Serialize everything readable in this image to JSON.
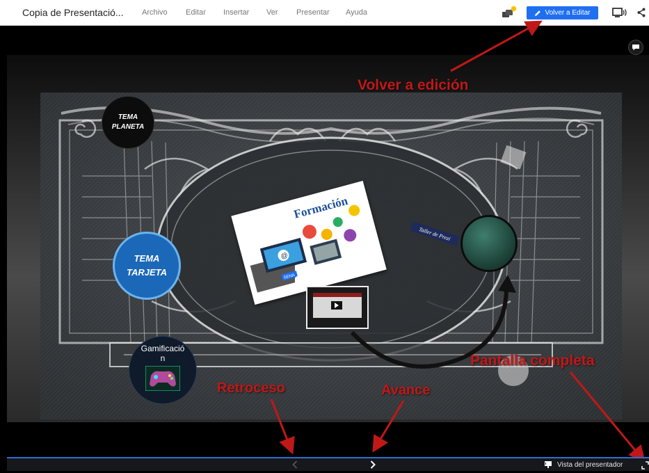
{
  "app": {
    "doc_title": "Copia de Presentació...",
    "menu": [
      "Archivo",
      "Editar",
      "Insertar",
      "Ver",
      "Presentar",
      "Ayuda"
    ],
    "edit_button_label": "Volver a Editar"
  },
  "slide": {
    "tema_planeta": [
      "TEMA",
      "PLANETA"
    ],
    "tema_tarjeta": [
      "TEMA",
      "TARJETA"
    ],
    "gamificacion": [
      "Gamificació",
      "n"
    ],
    "formacion_logo": "Formación",
    "taller_label": "Taller de Prezi",
    "badge_text": "SENA"
  },
  "annotations": {
    "volver": "Volver a edición",
    "pantalla": "Pantalla completa",
    "retroceso": "Retroceso",
    "avance": "Avance"
  },
  "footer": {
    "presenter_view": "Vista del presentador"
  },
  "colors": {
    "accent_blue": "#1f6ff1",
    "annotation_red": "#c01818",
    "collab_dot": "#f5c400"
  }
}
